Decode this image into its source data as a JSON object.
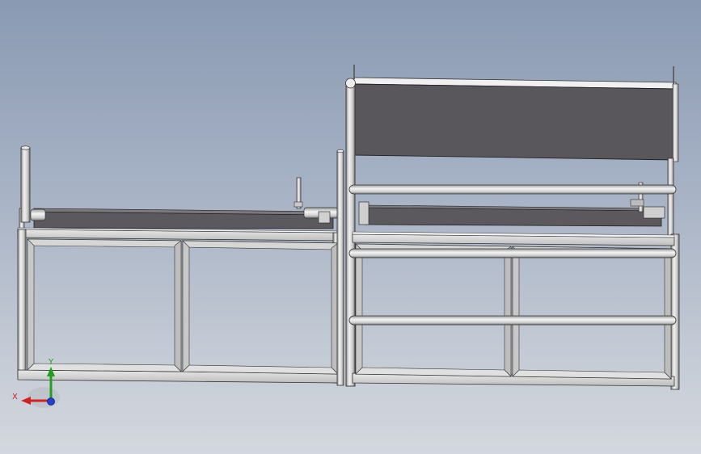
{
  "viewport": {
    "background_top": "#8a9ab3",
    "background_bottom": "#d3d7de"
  },
  "model": {
    "frame_color": "#d9d9d9",
    "frame_shade": "#9c9c9c",
    "outline_color": "#2a2a2a",
    "panel_color": "#59575c",
    "belt_color": "#5b595e"
  },
  "triad": {
    "x_label": "X",
    "y_label": "Y",
    "x_color": "#d42020",
    "y_color": "#1fa01f",
    "z_color": "#2040d0"
  }
}
